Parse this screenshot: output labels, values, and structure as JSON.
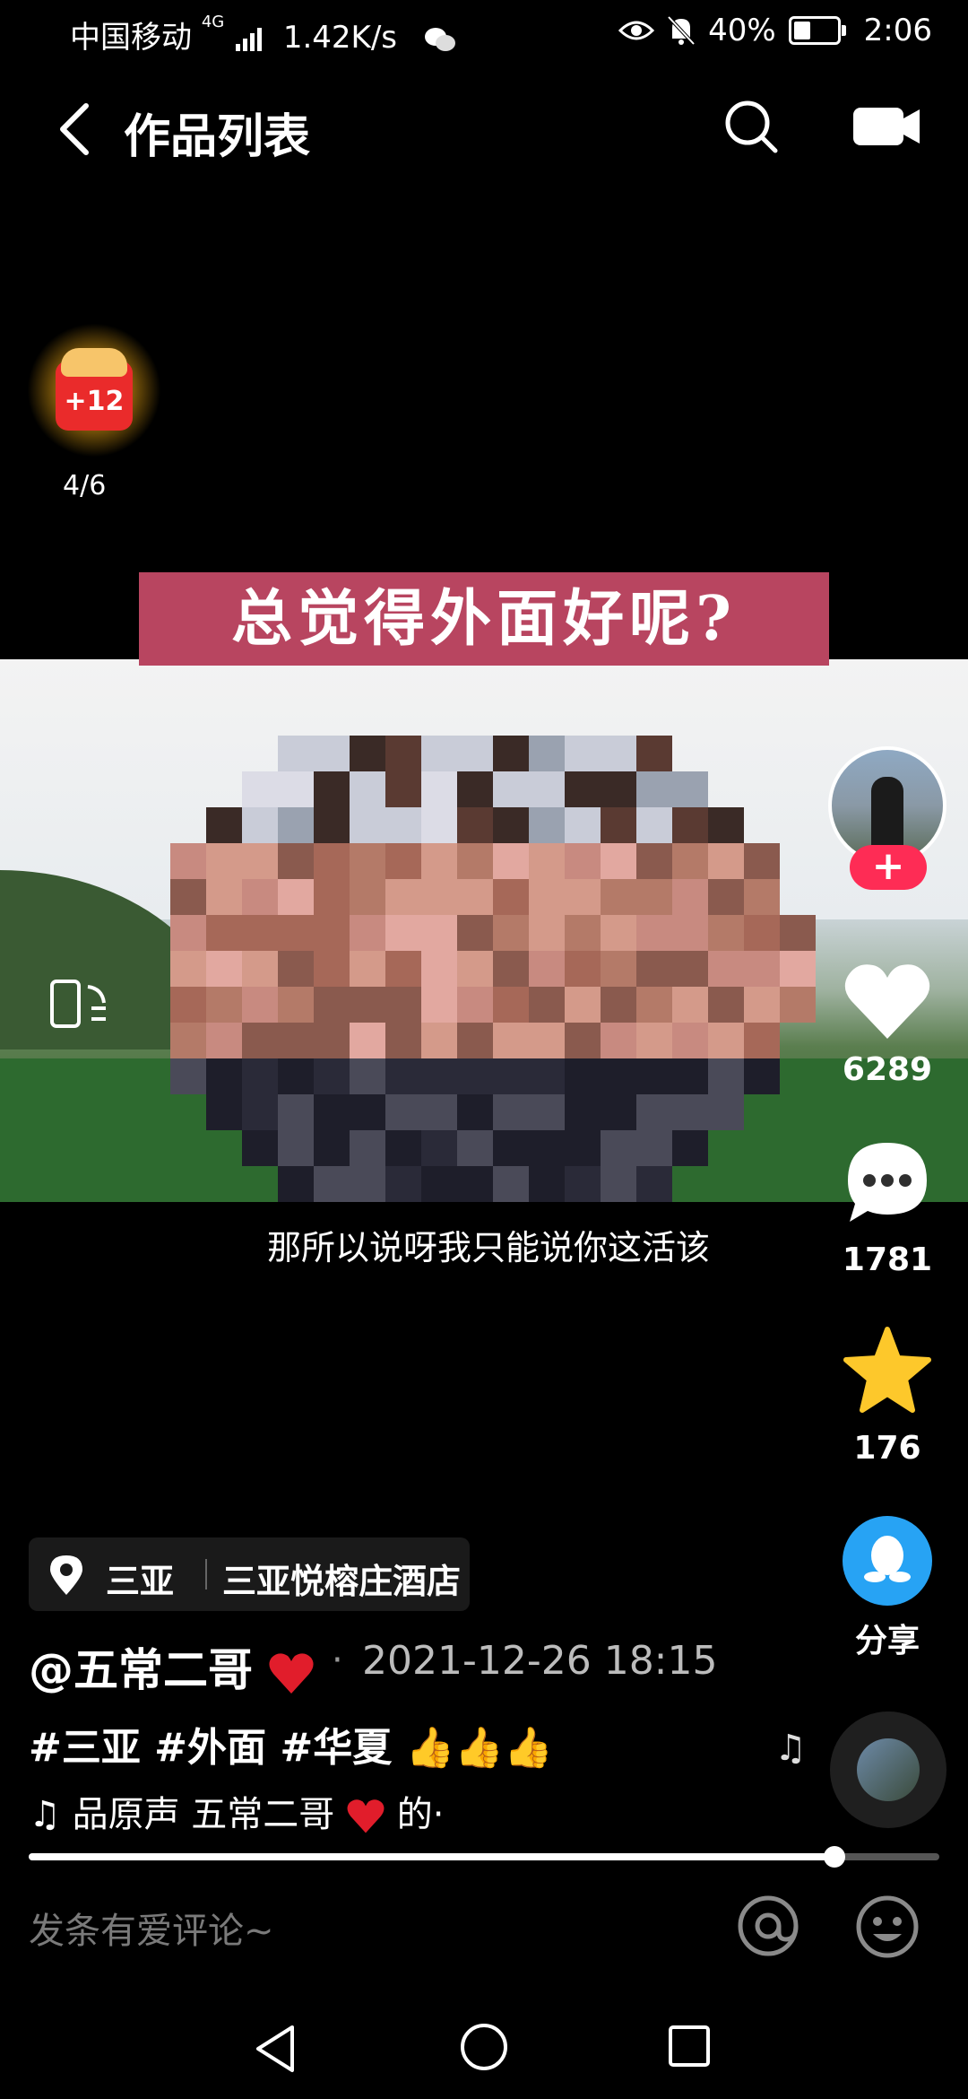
{
  "status_bar": {
    "carrier": "中国移动",
    "network_badge": "4G",
    "speed": "1.42K/s",
    "battery": "40%",
    "battery_level": 0.4,
    "time": "2:06"
  },
  "header": {
    "title": "作品列表",
    "back_icon": "chevron-left-icon",
    "search_icon": "search-icon",
    "camera_icon": "camera-icon"
  },
  "reward": {
    "badge": "+12",
    "count": "4/6"
  },
  "video": {
    "banner_text": "总觉得外面好呢?",
    "subtitle": "那所以说呀我只能说你这活该"
  },
  "right_rail": {
    "follow_label": "+",
    "likes": "6289",
    "comments": "1781",
    "favorites": "176",
    "share_label": "分享"
  },
  "info": {
    "location_city": "三亚",
    "location_place": "三亚悦榕庄酒店",
    "author": "@五常二哥",
    "separator": "·",
    "date": "2021-12-26 18:15",
    "tags": "#三亚 #外面 #华夏 👍👍👍",
    "music_prefix": "♫",
    "music_text": "品原声     五常二哥",
    "music_suffix": "的·"
  },
  "progress": {
    "fraction": 0.885
  },
  "comment_bar": {
    "placeholder": "发条有爱评论~"
  },
  "colors": {
    "accent": "#fe2c55",
    "star": "#fdc82b",
    "share_blue": "#27a3f4",
    "banner": "#b84560"
  }
}
